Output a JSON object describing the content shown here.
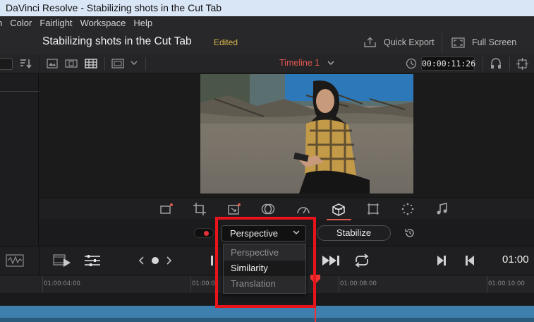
{
  "window": {
    "title": "DaVinci Resolve - Stabilizing shots in the Cut Tab"
  },
  "menu": {
    "items": [
      "n",
      "Color",
      "Fairlight",
      "Workspace",
      "Help"
    ]
  },
  "project": {
    "title": "Stabilizing shots in the Cut Tab",
    "status": "Edited"
  },
  "header_buttons": {
    "quick_export": "Quick Export",
    "full_screen": "Full Screen"
  },
  "viewer_toolbar": {
    "timeline_name": "Timeline 1",
    "timecode": "00:00:11:26"
  },
  "inspector_tabs": [
    "transform-icon",
    "crop-icon",
    "dynamic-zoom-icon",
    "composite-icon",
    "speed-icon",
    "stabilization-icon",
    "lens-correction-icon",
    "effects-icon",
    "audio-icon"
  ],
  "stabilize": {
    "mode_selected": "Perspective",
    "button_label": "Stabilize",
    "mode_options": [
      "Perspective",
      "Similarity",
      "Translation"
    ],
    "highlighted_option": "Similarity"
  },
  "transport": {
    "timecode": "01:00"
  },
  "ruler": {
    "labels": [
      "01:00:04:00",
      "01:00:0",
      "01:00:08:00",
      "01:00:10:00"
    ]
  },
  "colors": {
    "accent_red": "#e0574f",
    "edited_gold": "#d7b54a",
    "clip_blue": "#3f7fae",
    "annotation_red": "#e8141c"
  }
}
